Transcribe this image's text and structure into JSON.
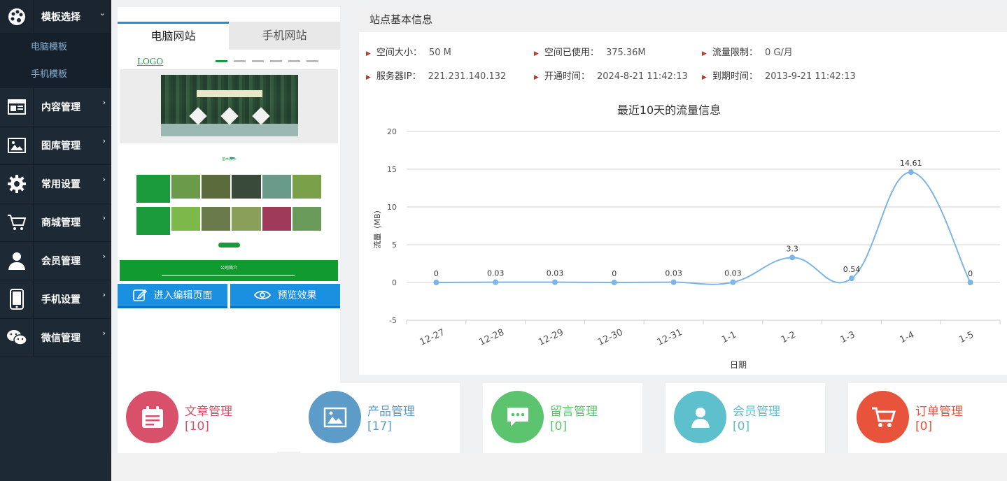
{
  "sidebar": {
    "items": [
      {
        "label": "模板选择",
        "icon": "palette-icon",
        "expanded": true
      },
      {
        "label": "内容管理",
        "icon": "newspaper-icon"
      },
      {
        "label": "图库管理",
        "icon": "image-icon"
      },
      {
        "label": "常用设置",
        "icon": "gear-icon"
      },
      {
        "label": "商城管理",
        "icon": "cart-icon"
      },
      {
        "label": "会员管理",
        "icon": "user-icon"
      },
      {
        "label": "手机设置",
        "icon": "phone-icon"
      },
      {
        "label": "微信管理",
        "icon": "wechat-icon"
      }
    ],
    "sub_items": [
      "电脑模板",
      "手机模板"
    ]
  },
  "preview": {
    "tabs": [
      "电脑网站",
      "手机网站"
    ],
    "thumb": {
      "logo": "LOGO",
      "section_title": "苗木展示",
      "footer_title": "公司简介"
    },
    "edit_button": "进入编辑页面",
    "preview_button": "预览效果"
  },
  "info": {
    "header": "站点基本信息",
    "rows": [
      [
        {
          "label": "空间大小：",
          "value": "50 M"
        },
        {
          "label": "空间已使用：",
          "value": "375.36M"
        },
        {
          "label": "流量限制：",
          "value": "0 G/月"
        }
      ],
      [
        {
          "label": "服务器IP：",
          "value": "221.231.140.132"
        },
        {
          "label": "开通时间：",
          "value": "2024-8-21 11:42:13"
        },
        {
          "label": "到期时间：",
          "value": "2013-9-21 11:42:13"
        }
      ]
    ]
  },
  "chart_data": {
    "type": "line",
    "title": "最近10天的流量信息",
    "xlabel": "日期",
    "ylabel": "流量（MB）",
    "categories": [
      "12-27",
      "12-28",
      "12-29",
      "12-30",
      "12-31",
      "1-1",
      "1-2",
      "1-3",
      "1-4",
      "1-5"
    ],
    "values": [
      0,
      0.03,
      0.03,
      0,
      0.03,
      0.03,
      3.3,
      0.54,
      14.61,
      0
    ],
    "data_labels": [
      "0",
      "0.03",
      "0.03",
      "0",
      "0.03",
      "0.03",
      "3.3",
      "0.54",
      "14.61",
      "0"
    ],
    "ylim": [
      -5,
      20
    ],
    "yticks": [
      "20",
      "15",
      "10",
      "5",
      "0",
      "-5"
    ],
    "grid": true,
    "smooth": true,
    "color": "#7cb5e6"
  },
  "stats": [
    {
      "name": "文章管理",
      "count": "[10]",
      "color": "#d9506a",
      "icon": "calendar-icon"
    },
    {
      "name": "产品管理",
      "count": "[17]",
      "color": "#5d9cc9",
      "icon": "picture-icon"
    },
    {
      "name": "留言管理",
      "count": "[0]",
      "color": "#5cc46e",
      "icon": "chat-bubble-icon"
    },
    {
      "name": "会员管理",
      "count": "[0]",
      "color": "#5dc0cc",
      "icon": "person-icon"
    },
    {
      "name": "订单管理",
      "count": "[0]",
      "color": "#e8533c",
      "icon": "cart-icon"
    }
  ]
}
